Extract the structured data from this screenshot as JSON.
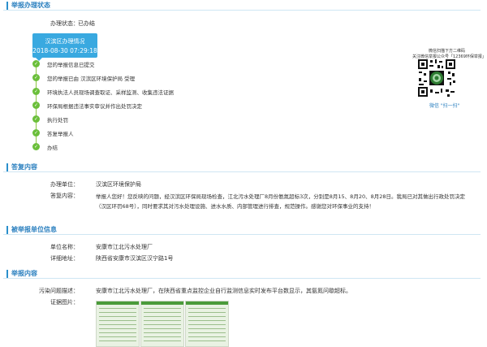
{
  "sections": {
    "status": "举报办理状态",
    "reply": "答复内容",
    "unit": "被举报单位信息",
    "report": "举报内容"
  },
  "status": {
    "label": "办理状态：",
    "value": "已办结",
    "box_title": "汉滨区办理情况",
    "box_time": "2018-08-30 07:29:18",
    "steps": [
      "您的举报信息已提交",
      "您的举报已由 汉滨区环境保护局 受理",
      "环境执法人员现场调查取证、采样监测、收集违法证据",
      "环保局根据违法事实审议并作出处罚决定",
      "执行处罚",
      "答复举报人",
      "办结"
    ]
  },
  "qr": {
    "caption1": "微信扫描下方二维码",
    "caption2": "关注微信举报公众号「12369环保举报」",
    "scan_label": "微信 \"扫一扫\""
  },
  "reply": {
    "unit_label": "办理单位：",
    "unit_value": "汉滨区环境保护局",
    "content_label": "答复内容：",
    "content_value": "举报人您好！您反映的问题，经汉滨区环保局现场检查，江北污水处理厂8月份氨氮超标3次，分别是8月15、8月20、8月28日。我局已对其做出行政处罚决定（汉区环罚68号），同时要求其对污水处理设施、进水水质、内部管理进行排查，规范操作。感谢您对环保事业的支持！"
  },
  "unit": {
    "name_label": "单位名称：",
    "name_value": "安康市江北污水处理厂",
    "addr_label": "详细地址：",
    "addr_value": "陕西省安康市汉滨区汉宁路1号"
  },
  "report": {
    "desc_label": "污染问题描述：",
    "desc_value": "安康市江北污水处理厂，在陕西省重点监控企业自行监测信息实时发布平台数显示，其氨氮问歇超标。",
    "photo_label": "证据图片："
  },
  "colors": {
    "accent": "#2a8fcc",
    "status_box": "#39a9e0",
    "step_green": "#6bbf3a"
  }
}
